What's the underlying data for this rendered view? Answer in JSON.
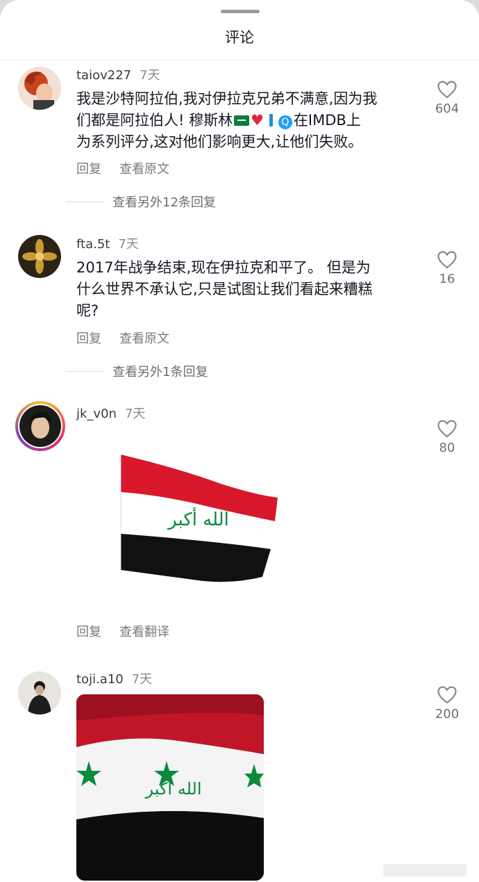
{
  "header": {
    "title": "评论"
  },
  "comments": [
    {
      "username": "taiov227",
      "time": "7天",
      "text_lines": [
        "我是沙特阿拉伯,我对伊拉克兄弟不满意,因为我",
        "们都是阿拉伯人! 穆斯林",
        "为系列评分,这对他们影响更大,让他们失败。"
      ],
      "text_line2_after": "在IMDB上",
      "reply_label": "回复",
      "secondary_label": "查看原文",
      "likes": "604",
      "more_replies": "查看另外12条回复"
    },
    {
      "username": "fta.5t",
      "time": "7天",
      "text_lines": [
        "2017年战争结束,现在伊拉克和平了。 但是为",
        "什么世界不承认它,只是试图让我们看起来糟糕",
        "呢?"
      ],
      "reply_label": "回复",
      "secondary_label": "查看原文",
      "likes": "16",
      "more_replies": "查看另外1条回复"
    },
    {
      "username": "jk_v0n",
      "time": "7天",
      "reply_label": "回复",
      "secondary_label": "查看翻译",
      "likes": "80",
      "flag_text": "الله أكبر"
    },
    {
      "username": "toji.a10",
      "time": "7天",
      "likes": "200",
      "flag_text": "الله أكبر"
    }
  ],
  "icons": {
    "like": "heart-outline-icon",
    "avatar": "user-avatar"
  },
  "colors": {
    "flag_red": "#d8182a",
    "flag_green": "#0a8a3b",
    "flag_black": "#111111",
    "text": "#161823",
    "muted": "#7a7a7a"
  }
}
